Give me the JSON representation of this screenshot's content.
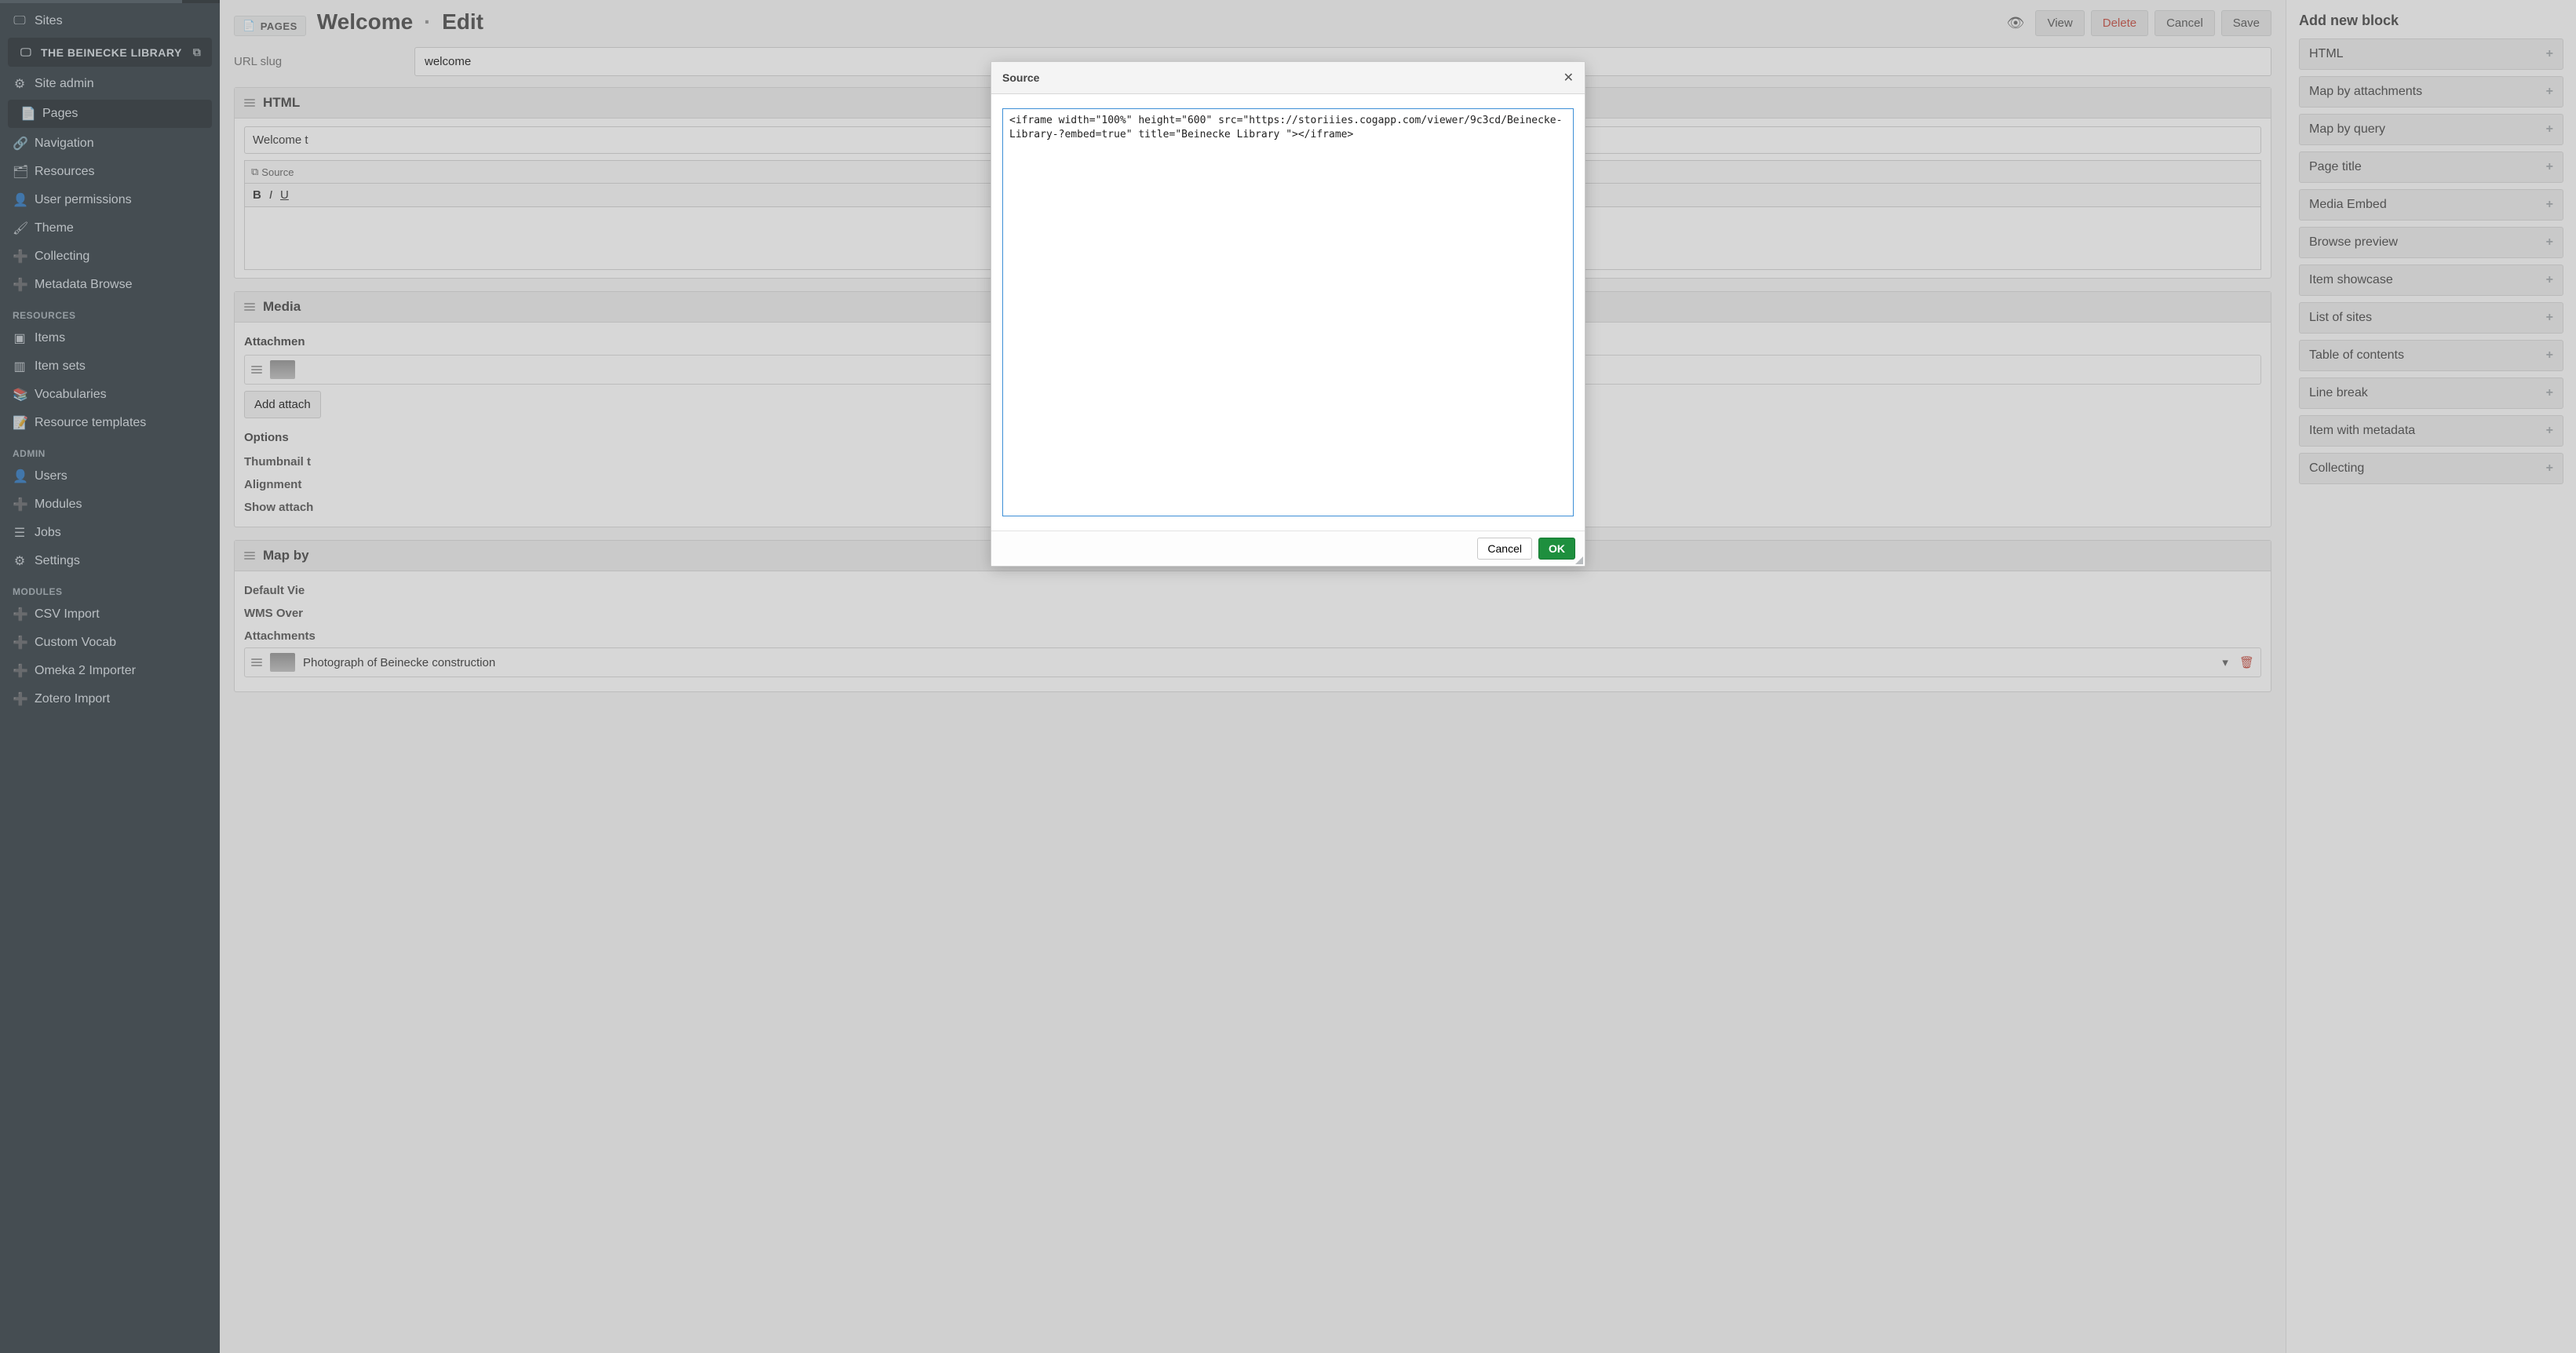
{
  "sidebar": {
    "sites_label": "Sites",
    "site_name": "THE BEINECKE LIBRARY",
    "site_items": [
      {
        "icon": "⚙",
        "label": "Site admin",
        "name": "site-admin"
      },
      {
        "icon": "📄",
        "label": "Pages",
        "name": "pages",
        "active": true
      },
      {
        "icon": "🔗",
        "label": "Navigation",
        "name": "navigation"
      },
      {
        "icon": "🗂",
        "label": "Resources",
        "name": "resources"
      },
      {
        "icon": "👤",
        "label": "User permissions",
        "name": "user-permissions"
      },
      {
        "icon": "🖌",
        "label": "Theme",
        "name": "theme"
      },
      {
        "icon": "➕",
        "label": "Collecting",
        "name": "collecting"
      },
      {
        "icon": "➕",
        "label": "Metadata Browse",
        "name": "metadata-browse"
      }
    ],
    "resources_heading": "RESOURCES",
    "resources_items": [
      {
        "icon": "▣",
        "label": "Items",
        "name": "items"
      },
      {
        "icon": "▥",
        "label": "Item sets",
        "name": "item-sets"
      },
      {
        "icon": "📚",
        "label": "Vocabularies",
        "name": "vocabularies"
      },
      {
        "icon": "📝",
        "label": "Resource templates",
        "name": "resource-templates"
      }
    ],
    "admin_heading": "ADMIN",
    "admin_items": [
      {
        "icon": "👤",
        "label": "Users",
        "name": "users"
      },
      {
        "icon": "➕",
        "label": "Modules",
        "name": "modules"
      },
      {
        "icon": "☰",
        "label": "Jobs",
        "name": "jobs"
      },
      {
        "icon": "⚙",
        "label": "Settings",
        "name": "settings"
      }
    ],
    "modules_heading": "MODULES",
    "modules_items": [
      {
        "icon": "➕",
        "label": "CSV Import",
        "name": "csv-import"
      },
      {
        "icon": "➕",
        "label": "Custom Vocab",
        "name": "custom-vocab"
      },
      {
        "icon": "➕",
        "label": "Omeka 2 Importer",
        "name": "omeka2-importer"
      },
      {
        "icon": "➕",
        "label": "Zotero Import",
        "name": "zotero-import"
      }
    ]
  },
  "header": {
    "pages_btn": "PAGES",
    "title": "Welcome",
    "sep": "·",
    "mode": "Edit",
    "actions": {
      "view": "View",
      "delete": "Delete",
      "cancel": "Cancel",
      "save": "Save"
    }
  },
  "url_slug": {
    "label": "URL slug",
    "value": "welcome"
  },
  "blocks": {
    "html": {
      "title": "HTML",
      "preview_text": "Welcome t",
      "toolbar": {
        "source": "Source",
        "bold": "B",
        "italic": "I",
        "underline": "U"
      }
    },
    "media": {
      "title": "Media ",
      "attachments_label": "Attachmen",
      "add_btn": "Add attach",
      "options_label": "Options",
      "thumbnail_label": "Thumbnail t",
      "alignment_label": "Alignment",
      "show_attach_label": "Show attach"
    },
    "map": {
      "title": "Map by",
      "default_view": "Default Vie",
      "wms": "WMS Over",
      "attachments": "Attachments",
      "attach1_label": "Photograph of Beinecke construction"
    }
  },
  "right_panel": {
    "heading": "Add new block",
    "items": [
      "HTML",
      "Map by attachments",
      "Map by query",
      "Page title",
      "Media Embed",
      "Browse preview",
      "Item showcase",
      "List of sites",
      "Table of contents",
      "Line break",
      "Item with metadata",
      "Collecting"
    ]
  },
  "modal": {
    "title": "Source",
    "textarea_value": "<iframe width=\"100%\" height=\"600\" src=\"https://storiiies.cogapp.com/viewer/9c3cd/Beinecke-Library-?embed=true\" title=\"Beinecke Library \"></iframe>",
    "cancel": "Cancel",
    "ok": "OK"
  }
}
